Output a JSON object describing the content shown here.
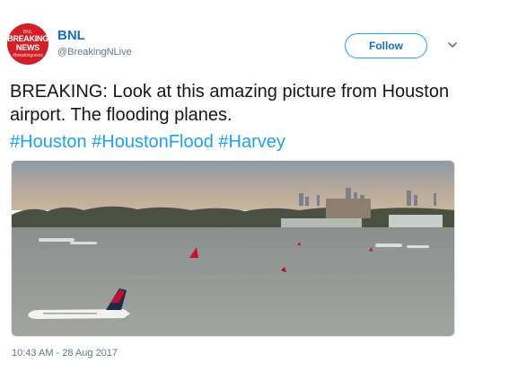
{
  "account": {
    "name": "BNL",
    "handle": "@BreakingNLive",
    "avatar_text": {
      "small": "BNL",
      "line1": "BREAKING",
      "line2": "NEWS",
      "tag": "#breakingnews"
    }
  },
  "follow_label": "Follow",
  "tweet": {
    "text": "BREAKING: Look at this amazing picture from Houston airport. The flooding planes.",
    "hashtags": [
      "#Houston",
      "#HoustonFlood",
      "#Harvey"
    ]
  },
  "timestamp": "10:43 AM - 28 Aug 2017",
  "icons": {
    "more": "chevron-down-icon"
  },
  "colors": {
    "link": "#1da1f2",
    "name": "#1d6fb5",
    "avatar": "#d21f26",
    "muted": "#657786",
    "tail_red": "#c8102e",
    "tail_navy": "#1c2b4a"
  }
}
